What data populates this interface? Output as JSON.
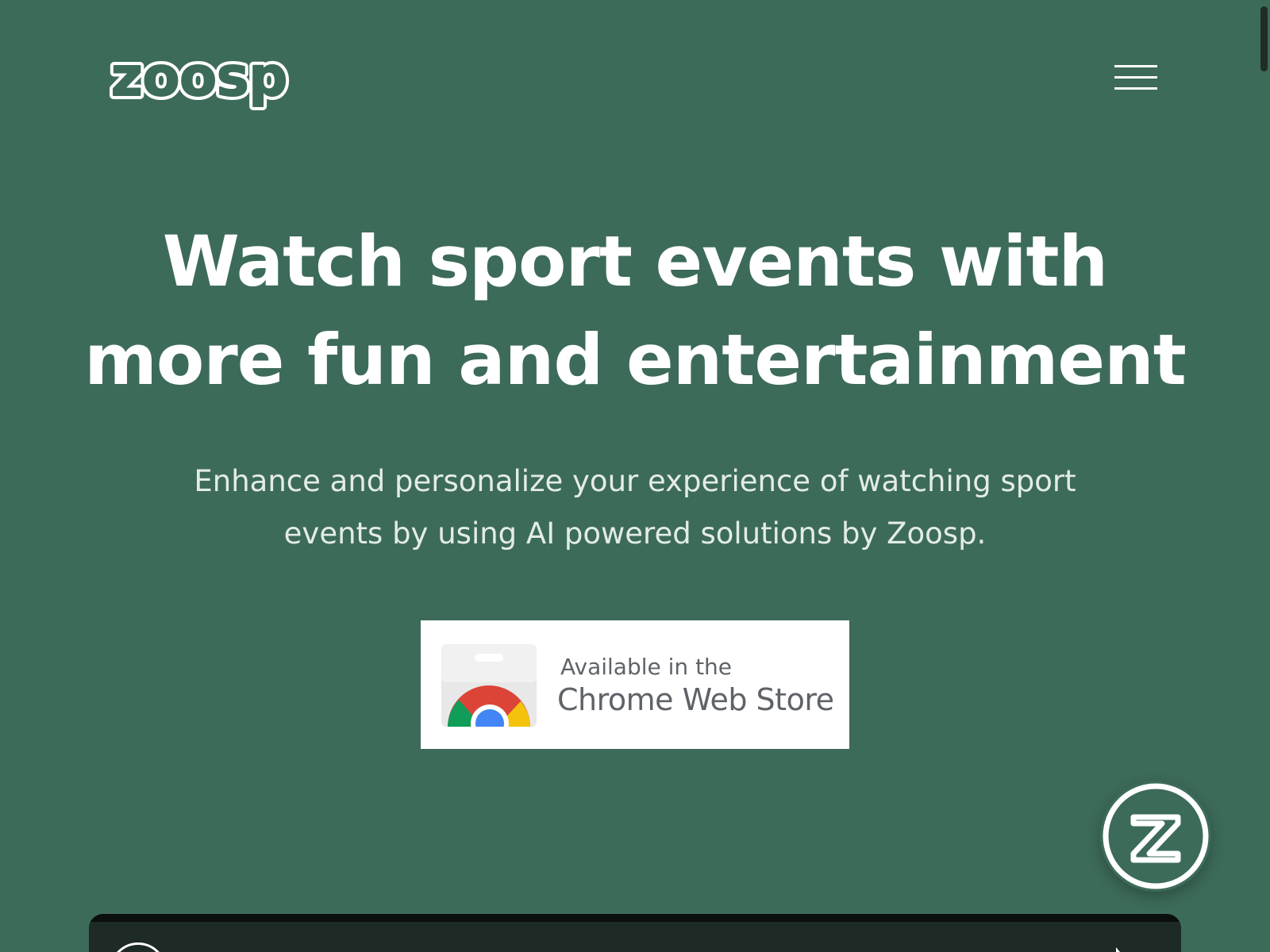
{
  "header": {
    "logo_text": "zoosp",
    "menu_icon": "hamburger-menu-icon"
  },
  "hero": {
    "title": "Watch sport events with more fun and entertainment",
    "subtitle": "Enhance and personalize your experience of watching sport events by using AI powered solutions by Zoosp."
  },
  "store_badge": {
    "small_text": "Available in the",
    "big_text": "Chrome Web Store",
    "icon": "chrome-web-store-icon"
  },
  "widget": {
    "icon": "zoosp-z-icon"
  },
  "video": {
    "avatar_icon": "zoosp-avatar-icon",
    "share_icon": "share-arrow-icon"
  },
  "colors": {
    "background": "#3d6b59",
    "text": "#ffffff",
    "subtitle": "#e3ece8",
    "badge_text": "#5f6368"
  }
}
